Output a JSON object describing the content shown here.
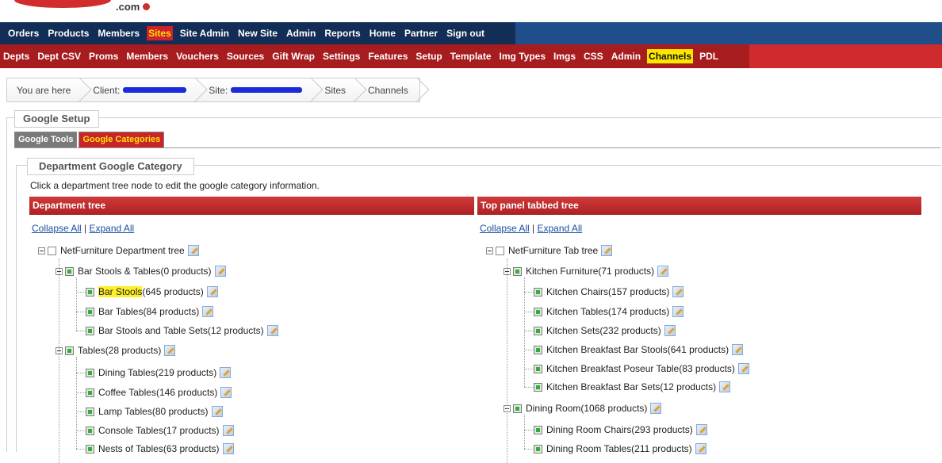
{
  "logo": {
    "suffix": ".com"
  },
  "main_nav": [
    {
      "label": "Orders",
      "active": false
    },
    {
      "label": "Products",
      "active": false
    },
    {
      "label": "Members",
      "active": false
    },
    {
      "label": "Sites",
      "active": true
    },
    {
      "label": "Site Admin",
      "active": false
    },
    {
      "label": "New Site",
      "active": false
    },
    {
      "label": "Admin",
      "active": false
    },
    {
      "label": "Reports",
      "active": false
    },
    {
      "label": "Home",
      "active": false
    },
    {
      "label": "Partner",
      "active": false
    },
    {
      "label": "Sign out",
      "active": false
    }
  ],
  "sub_nav": [
    {
      "label": "Depts",
      "active": false
    },
    {
      "label": "Dept CSV",
      "active": false
    },
    {
      "label": "Proms",
      "active": false
    },
    {
      "label": "Members",
      "active": false
    },
    {
      "label": "Vouchers",
      "active": false
    },
    {
      "label": "Sources",
      "active": false
    },
    {
      "label": "Gift Wrap",
      "active": false
    },
    {
      "label": "Settings",
      "active": false
    },
    {
      "label": "Features",
      "active": false
    },
    {
      "label": "Setup",
      "active": false
    },
    {
      "label": "Template",
      "active": false
    },
    {
      "label": "Img Types",
      "active": false
    },
    {
      "label": "Imgs",
      "active": false
    },
    {
      "label": "CSS",
      "active": false
    },
    {
      "label": "Admin",
      "active": false
    },
    {
      "label": "Channels",
      "active": true
    },
    {
      "label": "PDL",
      "active": false
    }
  ],
  "breadcrumb": {
    "you_are_here": "You are here",
    "client_label": "Client:",
    "site_label": "Site:",
    "sites": "Sites",
    "channels": "Channels"
  },
  "google_setup": {
    "legend": "Google Setup",
    "tabs": [
      {
        "label": "Google Tools",
        "active": false
      },
      {
        "label": "Google Categories",
        "active": true
      }
    ]
  },
  "dept_category": {
    "legend": "Department Google Category",
    "instructions": "Click a department tree node to edit the google category information."
  },
  "left_panel": {
    "header": "Department tree",
    "collapse_all": "Collapse All",
    "separator": " | ",
    "expand_all": "Expand All",
    "root": "NetFurniture Department tree",
    "groups": [
      {
        "name": "Bar Stools & Tables",
        "count": " (0 products)",
        "children": [
          {
            "name": "Bar Stools",
            "count": " (645 products)",
            "highlight": true
          },
          {
            "name": "Bar Tables",
            "count": " (84 products)",
            "highlight": false
          },
          {
            "name": "Bar Stools and Table Sets",
            "count": " (12 products)",
            "highlight": false
          }
        ]
      },
      {
        "name": "Tables",
        "count": " (28 products)",
        "children": [
          {
            "name": "Dining Tables",
            "count": " (219 products)",
            "highlight": false
          },
          {
            "name": "Coffee Tables",
            "count": " (146 products)",
            "highlight": false
          },
          {
            "name": "Lamp Tables",
            "count": " (80 products)",
            "highlight": false
          },
          {
            "name": "Console Tables",
            "count": " (17 products)",
            "highlight": false
          },
          {
            "name": "Nests of Tables",
            "count": " (63 products)",
            "highlight": false
          }
        ]
      }
    ]
  },
  "right_panel": {
    "header": "Top panel tabbed tree",
    "collapse_all": "Collapse All",
    "separator": " | ",
    "expand_all": "Expand All",
    "root": "NetFurniture Tab tree",
    "groups": [
      {
        "name": "Kitchen Furniture",
        "count": " (71 products)",
        "children": [
          {
            "name": "Kitchen Chairs",
            "count": " (157 products)"
          },
          {
            "name": "Kitchen Tables",
            "count": " (174 products)"
          },
          {
            "name": "Kitchen Sets",
            "count": " (232 products)"
          },
          {
            "name": "Kitchen Breakfast Bar Stools",
            "count": " (641 products)"
          },
          {
            "name": "Kitchen Breakfast Poseur Table",
            "count": " (83 products)"
          },
          {
            "name": "Kitchen Breakfast Bar Sets",
            "count": " (12 products)"
          }
        ]
      },
      {
        "name": "Dining Room",
        "count": " (1068 products)",
        "children": [
          {
            "name": "Dining Room Chairs",
            "count": " (293 products)"
          },
          {
            "name": "Dining Room Tables",
            "count": " (211 products)"
          }
        ]
      }
    ]
  }
}
